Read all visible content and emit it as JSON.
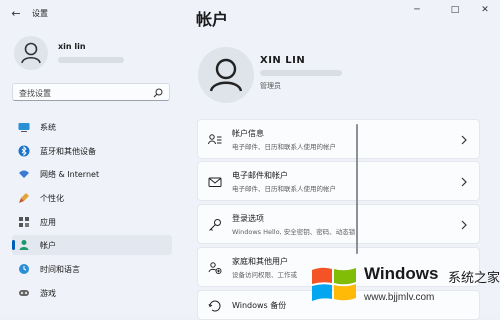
{
  "window": {
    "app_title": "设置",
    "page_title": "帐户"
  },
  "titlebar": {
    "back_glyph": "←",
    "minimize_glyph": "─",
    "maximize_glyph": "□",
    "close_glyph": "✕"
  },
  "sidebar": {
    "user_name": "xin lin",
    "search_placeholder": "查找设置",
    "items": [
      {
        "label": "系统",
        "icon": "monitor-icon"
      },
      {
        "label": "蓝牙和其他设备",
        "icon": "bluetooth-icon"
      },
      {
        "label": "网络 & Internet",
        "icon": "wifi-icon"
      },
      {
        "label": "个性化",
        "icon": "brush-icon"
      },
      {
        "label": "应用",
        "icon": "apps-icon"
      },
      {
        "label": "帐户",
        "icon": "person-icon",
        "selected": true
      },
      {
        "label": "时间和语言",
        "icon": "globe-clock-icon"
      },
      {
        "label": "游戏",
        "icon": "gamepad-icon"
      }
    ]
  },
  "account": {
    "name": "XIN LIN",
    "role": "管理员"
  },
  "cards": [
    {
      "title": "帐户信息",
      "desc": "电子邮件、日历和联系人使用的帐户",
      "icon": "account-info-icon"
    },
    {
      "title": "电子邮件和帐户",
      "desc": "电子邮件、日历和联系人使用的帐户",
      "icon": "mail-icon"
    },
    {
      "title": "登录选项",
      "desc": "Windows Hello, 安全密钥、密码、动态锁",
      "icon": "key-icon"
    },
    {
      "title": "家庭和其他用户",
      "desc": "设备访问权限、工作或",
      "icon": "family-icon"
    },
    {
      "title": "Windows 备份",
      "desc": "",
      "icon": "backup-icon"
    }
  ],
  "watermark": {
    "brand": "Windows",
    "suffix": "系统之家",
    "url": "www.bjjmlv.com"
  },
  "colors": {
    "accent": "#005fb8",
    "background": "#eff2f8",
    "card": "#fbfcfe"
  }
}
